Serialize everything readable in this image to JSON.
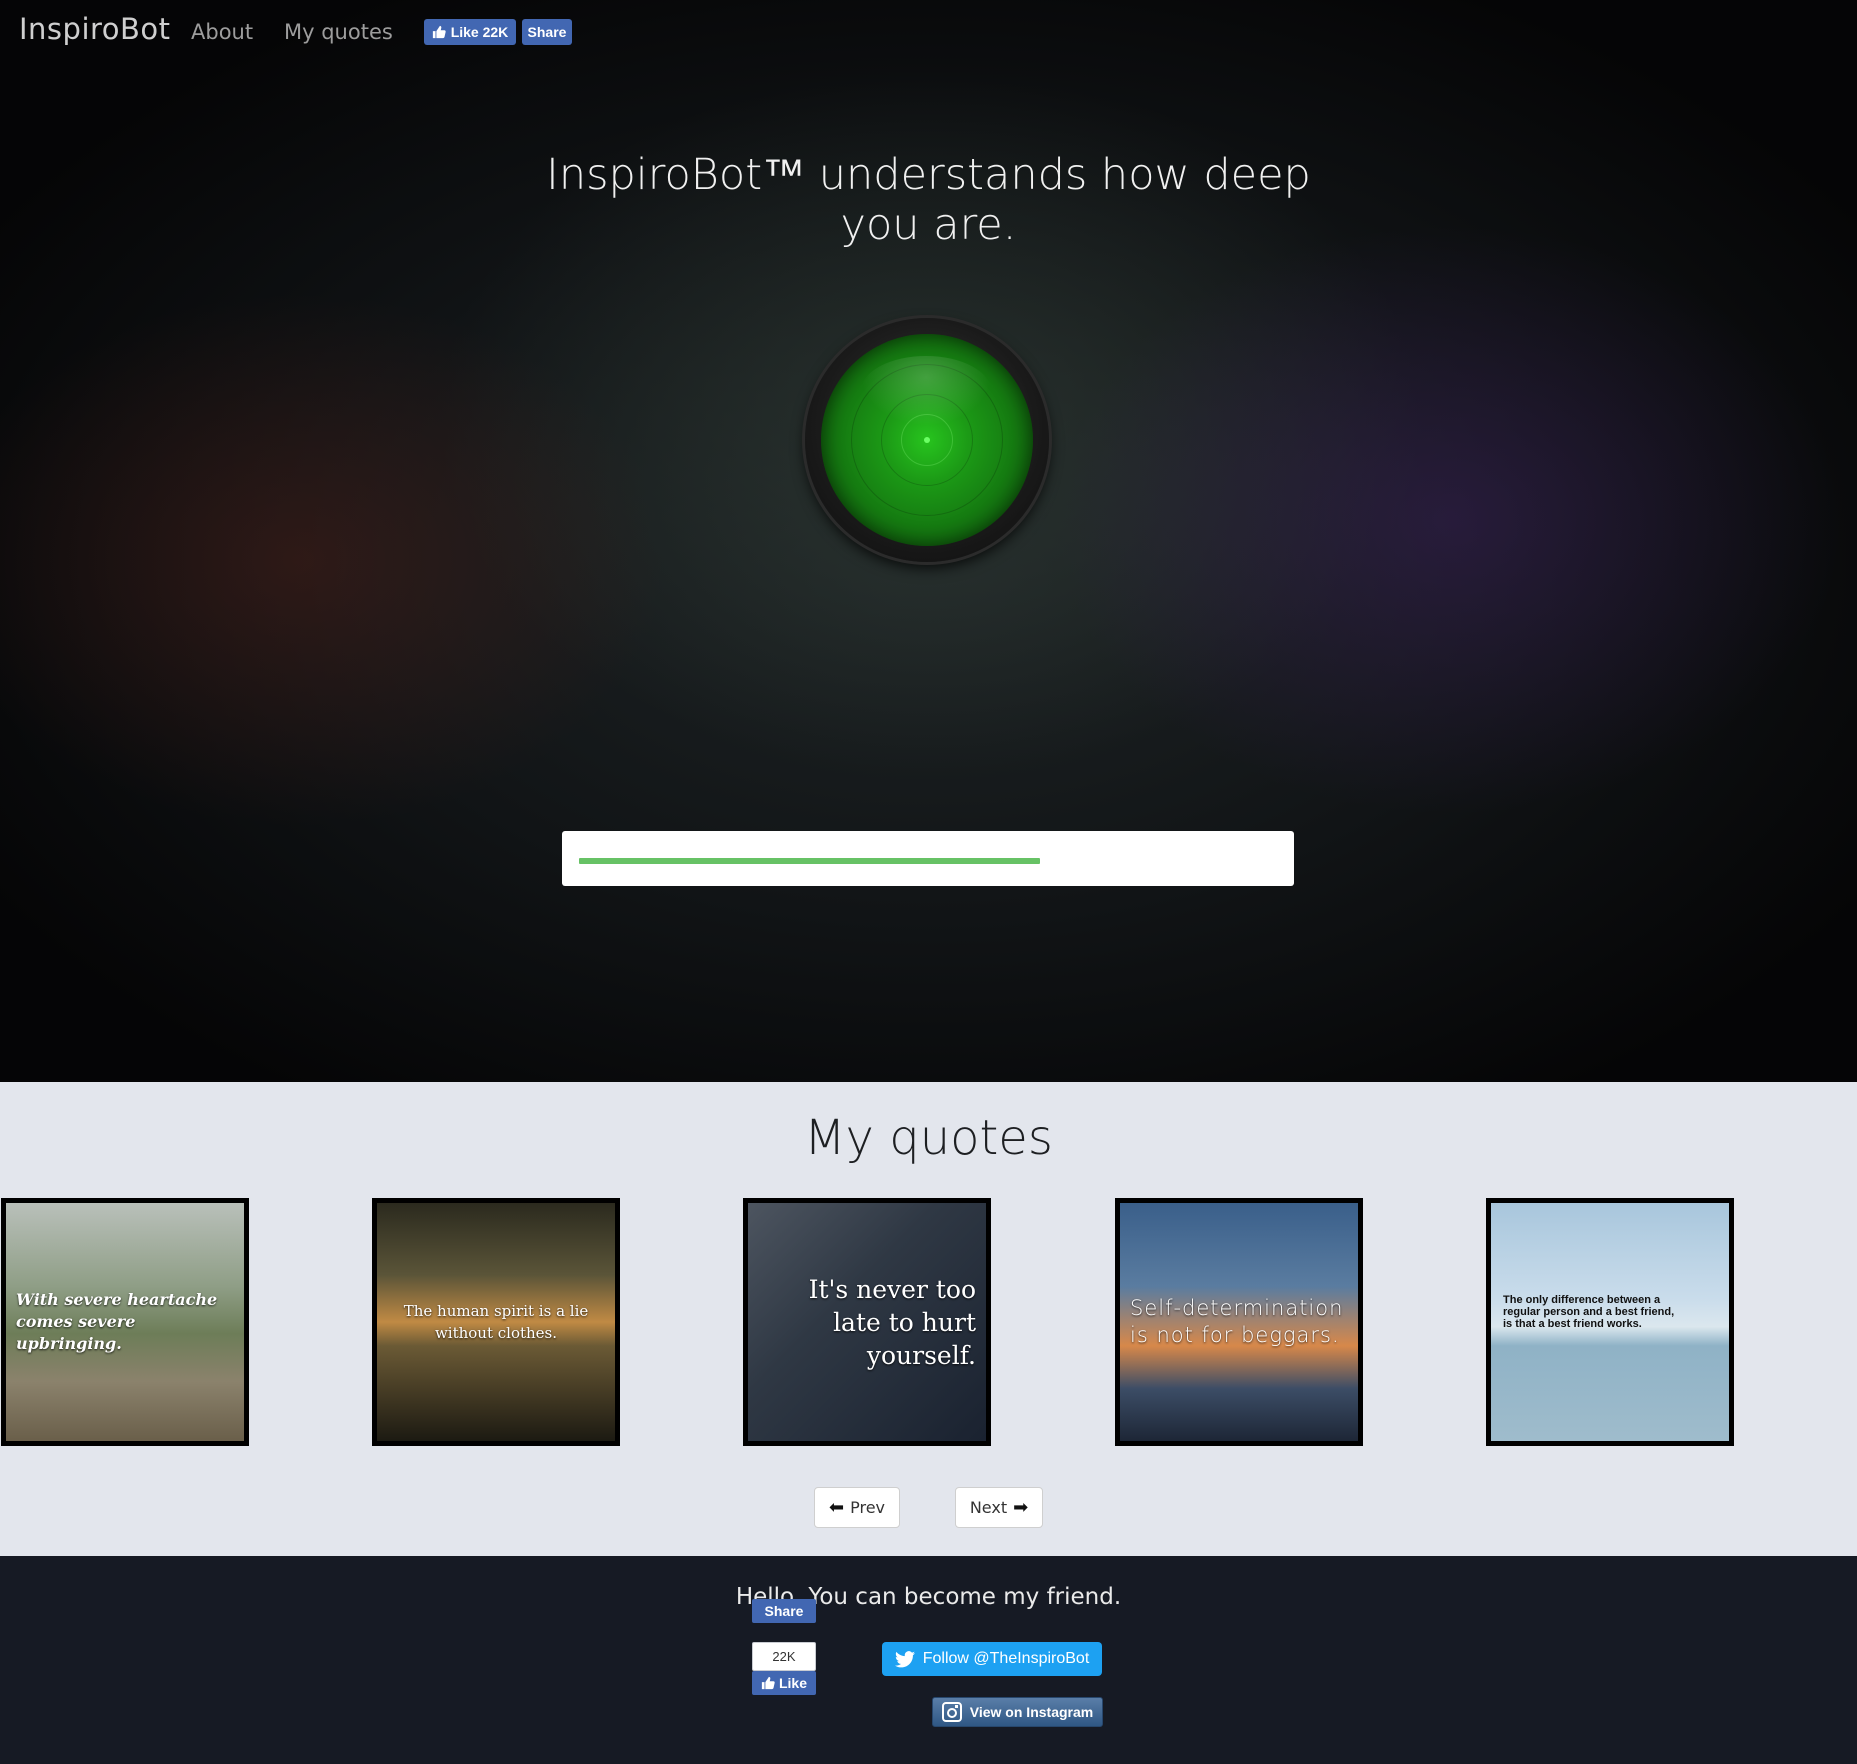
{
  "nav": {
    "brand": "InspiroBot",
    "links": [
      "About",
      "My quotes"
    ],
    "fb_like_label": "Like 22K",
    "fb_share_label": "Share"
  },
  "hero": {
    "headline": "InspiroBot™ understands how deep you are.",
    "generate_icon": "glowing-green-button",
    "progress_fraction": 0.66,
    "accent_color": "#67c265"
  },
  "quotes_section": {
    "title": "My quotes",
    "cards": [
      {
        "text": "With severe heartache comes severe upbringing."
      },
      {
        "text": "The human spirit is a lie without clothes."
      },
      {
        "text": "It's never too late to hurt yourself."
      },
      {
        "text": "Self-determination is not for beggars."
      },
      {
        "text": "The only difference between a regular person and a best friend, is that a best friend works."
      }
    ],
    "prev_label": "Prev",
    "next_label": "Next"
  },
  "footer": {
    "tagline": "Hello. You can become my friend.",
    "fb_count": "22K",
    "fb_like_label": "Like",
    "fb_share_label": "Share",
    "twitter_label": "Follow @TheInspiroBot",
    "instagram_label": "View on Instagram"
  }
}
